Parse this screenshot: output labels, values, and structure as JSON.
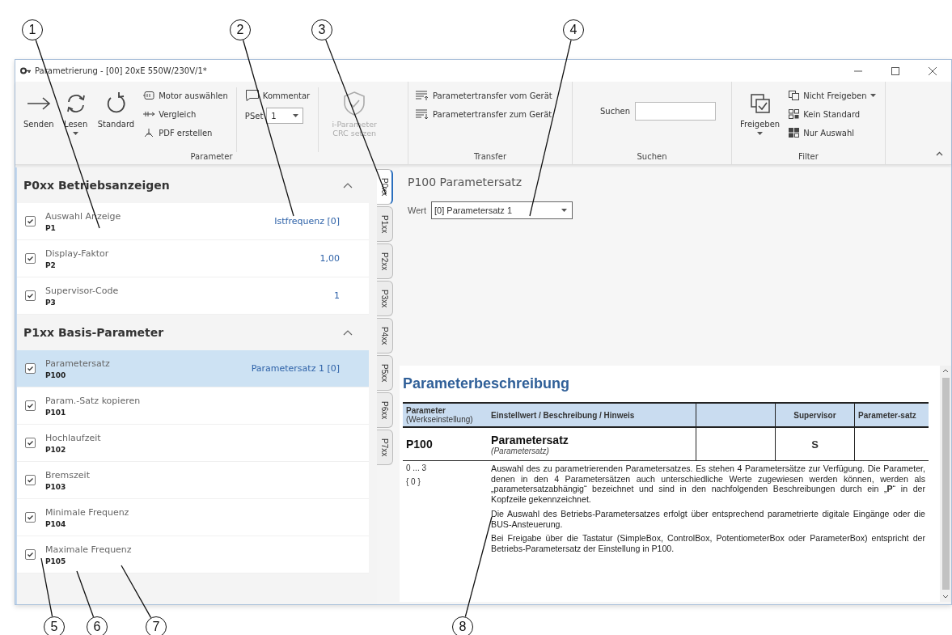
{
  "window": {
    "title": "Parametrierung - [00] 20xE 550W/230V/1*"
  },
  "ribbon": {
    "groups": [
      {
        "label": "Parameter",
        "items": [
          {
            "kind": "large",
            "label": "Senden"
          },
          {
            "kind": "large",
            "label": "Lesen",
            "dropdown": true
          },
          {
            "kind": "large",
            "label": "Standard"
          },
          {
            "kind": "column",
            "items": [
              {
                "kind": "small",
                "label": "Motor auswählen"
              },
              {
                "kind": "small",
                "label": "Vergleich"
              },
              {
                "kind": "small",
                "label": "PDF erstellen"
              }
            ]
          },
          {
            "kind": "separator"
          },
          {
            "kind": "column",
            "items": [
              {
                "kind": "small",
                "label": "Kommentar"
              },
              {
                "kind": "select",
                "label": "PSet",
                "value": "1"
              }
            ]
          },
          {
            "kind": "separator"
          },
          {
            "kind": "large",
            "label": "i-Parameter CRC setzen",
            "disabled": true
          }
        ]
      },
      {
        "label": "Transfer",
        "items": [
          {
            "kind": "column",
            "items": [
              {
                "kind": "small",
                "label": "Parametertransfer vom Gerät"
              },
              {
                "kind": "small",
                "label": "Parametertransfer zum Gerät"
              }
            ]
          }
        ]
      },
      {
        "label": "Suchen",
        "items": [
          {
            "kind": "search",
            "label": "Suchen"
          }
        ]
      },
      {
        "label": "Filter",
        "items": [
          {
            "kind": "large",
            "label": "Freigeben",
            "dropdown": true
          },
          {
            "kind": "column",
            "items": [
              {
                "kind": "small",
                "label": "Nicht Freigeben",
                "dropdown": true
              },
              {
                "kind": "small",
                "label": "Kein Standard"
              },
              {
                "kind": "small",
                "label": "Nur Auswahl"
              }
            ]
          }
        ]
      }
    ]
  },
  "parameter_list": {
    "sections": [
      {
        "title": "P0xx Betriebsanzeigen",
        "expanded": true,
        "rows": [
          {
            "name": "Auswahl Anzeige",
            "code": "P1",
            "value": "Istfrequenz [0]",
            "checked": true,
            "selected": false
          },
          {
            "name": "Display-Faktor",
            "code": "P2",
            "value": "1,00",
            "checked": true,
            "selected": false
          },
          {
            "name": "Supervisor-Code",
            "code": "P3",
            "value": "1",
            "checked": true,
            "selected": false
          }
        ]
      },
      {
        "title": "P1xx Basis-Parameter",
        "expanded": true,
        "rows": [
          {
            "name": "Parametersatz",
            "code": "P100",
            "value": "Parametersatz 1 [0]",
            "checked": true,
            "selected": true
          },
          {
            "name": "Param.-Satz kopieren",
            "code": "P101",
            "checked": true,
            "selected": false
          },
          {
            "name": "Hochlaufzeit",
            "code": "P102",
            "checked": true,
            "selected": false
          },
          {
            "name": "Bremszeit",
            "code": "P103",
            "checked": true,
            "selected": false
          },
          {
            "name": "Minimale Frequenz",
            "code": "P104",
            "checked": true,
            "selected": false
          },
          {
            "name": "Maximale Frequenz",
            "code": "P105",
            "checked": true,
            "selected": false
          }
        ]
      }
    ]
  },
  "tabs": [
    {
      "label": "P0xx",
      "selected": true
    },
    {
      "label": "P1xx",
      "selected": false
    },
    {
      "label": "P2xx",
      "selected": false
    },
    {
      "label": "P3xx",
      "selected": false
    },
    {
      "label": "P4xx",
      "selected": false
    },
    {
      "label": "P5xx",
      "selected": false
    },
    {
      "label": "P6xx",
      "selected": false
    },
    {
      "label": "P7xx",
      "selected": false
    }
  ],
  "detail": {
    "title": "P100 Parametersatz",
    "field": {
      "label": "Wert",
      "value": "[0] Parametersatz 1"
    }
  },
  "description": {
    "heading": "Parameterbeschreibung",
    "columns": [
      {
        "label": "Parameter",
        "sub": "(Werkseinstellung)"
      },
      {
        "label": "Einstellwert / Beschreibung / Hinweis"
      },
      {
        "label": "Supervisor"
      },
      {
        "label": "Parameter-satz"
      }
    ],
    "row": {
      "code": "P100",
      "name": "Parametersatz",
      "alias": "(Parametersatz)",
      "supervisor": "S"
    },
    "range": "0 ... 3",
    "default": "{ 0 }",
    "paragraphs": [
      "Auswahl des zu parametrierenden Parametersatzes. Es stehen 4 Parametersätze zur Verfügung. Die Parameter, denen in den 4 Parametersätzen auch unterschiedliche Werte zugewiesen werden können, werden als „parametersatzabhängig“ bezeichnet und sind in den nachfolgenden Beschreibungen durch ein „**P**“ in der Kopfzeile gekennzeichnet.",
      "Die Auswahl des Betriebs-Parametersatzes erfolgt über entsprechend parametrierte digitale Eingänge oder die BUS-Ansteuerung.",
      "Bei Freigabe über die Tastatur (SimpleBox, ControlBox, PotentiometerBox oder ParameterBox) entspricht der Betriebs-Parametersatz der Einstellung in P100."
    ]
  },
  "callouts": [
    {
      "number": "1"
    },
    {
      "number": "2"
    },
    {
      "number": "3"
    },
    {
      "number": "4"
    },
    {
      "number": "5"
    },
    {
      "number": "6"
    },
    {
      "number": "7"
    },
    {
      "number": "8"
    }
  ]
}
